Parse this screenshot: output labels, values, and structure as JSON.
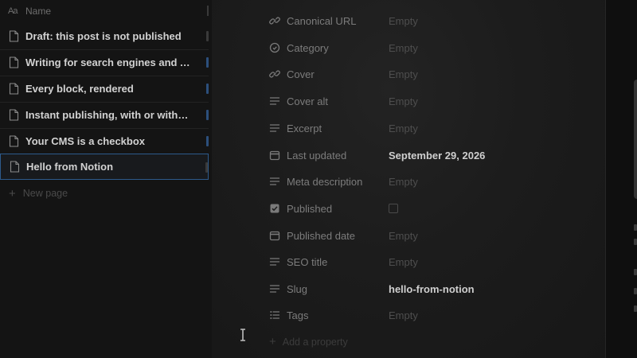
{
  "database": {
    "header": {
      "type_glyph": "Aa",
      "column_name": "Name"
    },
    "rows": [
      {
        "title": "Draft: this post is not published",
        "mark_color": "#3a3a3a"
      },
      {
        "title": "Writing for search engines and AI ...",
        "mark_color": "#2c4f7c"
      },
      {
        "title": "Every block, rendered",
        "mark_color": "#2c4f7c"
      },
      {
        "title": "Instant publishing, with or withou...",
        "mark_color": "#2c4f7c"
      },
      {
        "title": "Your CMS is a checkbox",
        "mark_color": "#2c4f7c"
      },
      {
        "title": "Hello from Notion",
        "mark_color": "#3a3a3a",
        "selected": true
      }
    ],
    "new_page_label": "New page"
  },
  "properties": [
    {
      "icon": "link-icon",
      "label": "Canonical URL",
      "value": "Empty",
      "empty": true
    },
    {
      "icon": "category-icon",
      "label": "Category",
      "value": "Empty",
      "empty": true
    },
    {
      "icon": "link-icon",
      "label": "Cover",
      "value": "Empty",
      "empty": true
    },
    {
      "icon": "text-icon",
      "label": "Cover alt",
      "value": "Empty",
      "empty": true
    },
    {
      "icon": "text-icon",
      "label": "Excerpt",
      "value": "Empty",
      "empty": true
    },
    {
      "icon": "calendar-icon",
      "label": "Last updated",
      "value": "September 29, 2026",
      "empty": false
    },
    {
      "icon": "text-icon",
      "label": "Meta description",
      "value": "Empty",
      "empty": true
    },
    {
      "icon": "checkbox-icon",
      "label": "Published",
      "value": "",
      "checkbox": true
    },
    {
      "icon": "calendar-icon",
      "label": "Published date",
      "value": "Empty",
      "empty": true
    },
    {
      "icon": "text-icon",
      "label": "SEO title",
      "value": "Empty",
      "empty": true
    },
    {
      "icon": "text-icon",
      "label": "Slug",
      "value": "hello-from-notion",
      "empty": false
    },
    {
      "icon": "list-icon",
      "label": "Tags",
      "value": "Empty",
      "empty": true
    }
  ],
  "add_property_label": "Add a property",
  "colors": {
    "selected_border": "#2d5a8c",
    "edge_blue": "#2c4f7c",
    "muted_label": "#7c7c7c",
    "empty_value": "#4e4e4e",
    "filled_value": "#cfcfcf"
  }
}
